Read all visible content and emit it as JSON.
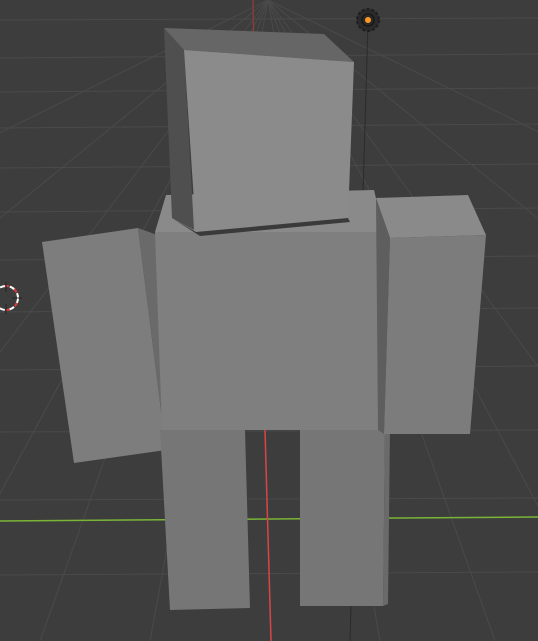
{
  "viewport": {
    "mode": "3D Viewport",
    "shading": "solid",
    "background_color": "#3d3d3d",
    "grid_line_color": "#4d4d4d",
    "x_axis_color": "#d94545",
    "y_axis_color": "#7ab536",
    "z_axis_color": "#7a3a3a"
  },
  "scene": {
    "objects": [
      {
        "name": "head",
        "shape": "cube"
      },
      {
        "name": "torso",
        "shape": "cube"
      },
      {
        "name": "right-arm",
        "shape": "cube"
      },
      {
        "name": "left-arm",
        "shape": "cube"
      },
      {
        "name": "right-leg",
        "shape": "cube"
      },
      {
        "name": "left-leg",
        "shape": "cube"
      }
    ],
    "extras": {
      "light_icon": "light-icon",
      "cursor_icon": "3d-cursor-icon"
    }
  }
}
